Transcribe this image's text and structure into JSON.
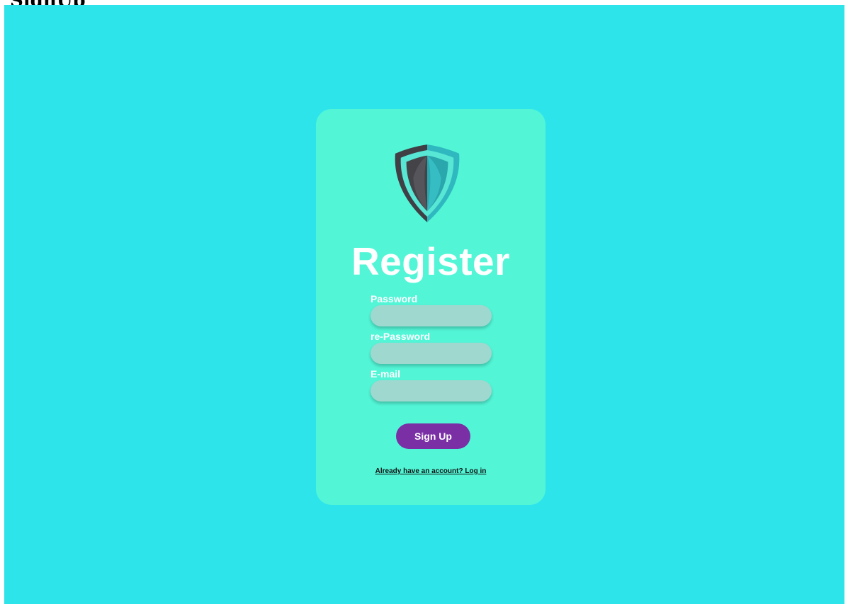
{
  "page": {
    "heading": "SignUp"
  },
  "card": {
    "logo_icon": "shield-icon",
    "title": "Register",
    "fields": [
      {
        "label": "Password",
        "value": "",
        "placeholder": ""
      },
      {
        "label": "re-Password",
        "value": "",
        "placeholder": ""
      },
      {
        "label": "E-mail",
        "value": "",
        "placeholder": ""
      }
    ],
    "submit_label": "Sign Up",
    "login_link": "Already have an account? Log in"
  },
  "colors": {
    "background": "#2ee4eb",
    "card": "#52f6d7",
    "input": "#9fd8cf",
    "button": "#7a2fa5",
    "title_text": "#ffffff"
  }
}
